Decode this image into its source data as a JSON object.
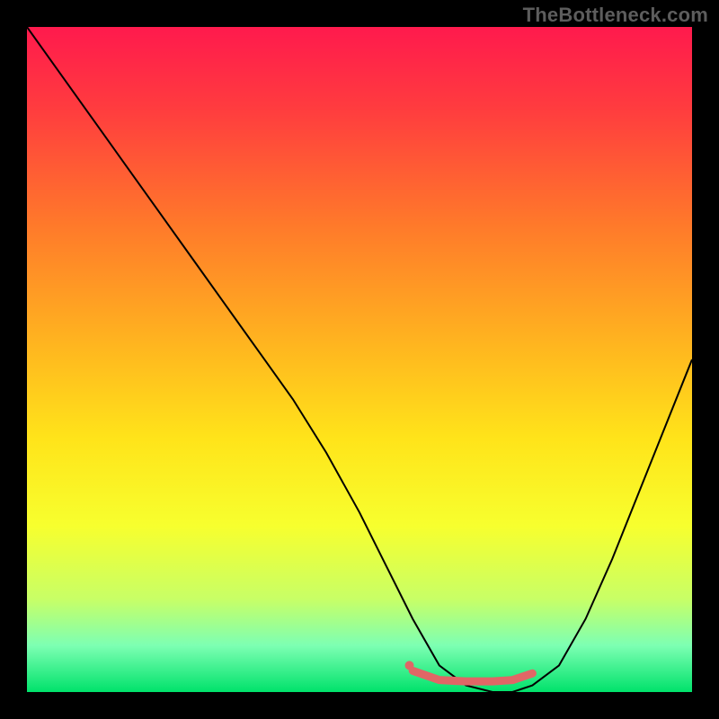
{
  "attribution": "TheBottleneck.com",
  "chart_data": {
    "type": "line",
    "title": "",
    "xlabel": "",
    "ylabel": "",
    "xlim": [
      0,
      100
    ],
    "ylim": [
      0,
      100
    ],
    "background_gradient": {
      "stops": [
        {
          "offset": 0.0,
          "color": "#ff1a4d"
        },
        {
          "offset": 0.12,
          "color": "#ff3b3f"
        },
        {
          "offset": 0.3,
          "color": "#ff7a2a"
        },
        {
          "offset": 0.48,
          "color": "#ffb61f"
        },
        {
          "offset": 0.62,
          "color": "#ffe41a"
        },
        {
          "offset": 0.75,
          "color": "#f7ff2e"
        },
        {
          "offset": 0.86,
          "color": "#c8ff66"
        },
        {
          "offset": 0.93,
          "color": "#7dffb3"
        },
        {
          "offset": 1.0,
          "color": "#00e26b"
        }
      ]
    },
    "series": [
      {
        "name": "bottleneck-curve",
        "color": "#000000",
        "stroke_width": 2,
        "x": [
          0,
          5,
          10,
          15,
          20,
          25,
          30,
          35,
          40,
          45,
          50,
          54,
          58,
          62,
          66,
          70,
          73,
          76,
          80,
          84,
          88,
          92,
          96,
          100
        ],
        "y": [
          100,
          93,
          86,
          79,
          72,
          65,
          58,
          51,
          44,
          36,
          27,
          19,
          11,
          4,
          1,
          0,
          0,
          1,
          4,
          11,
          20,
          30,
          40,
          50
        ]
      },
      {
        "name": "optimal-band",
        "color": "#e06666",
        "stroke_width": 9,
        "linecap": "round",
        "x": [
          58,
          62,
          66,
          70,
          73,
          76
        ],
        "y": [
          3.2,
          1.8,
          1.6,
          1.6,
          1.8,
          2.8
        ]
      }
    ],
    "markers": [
      {
        "name": "optimal-start-dot",
        "x": 57.5,
        "y": 4.0,
        "r": 5,
        "color": "#e06666"
      }
    ]
  }
}
